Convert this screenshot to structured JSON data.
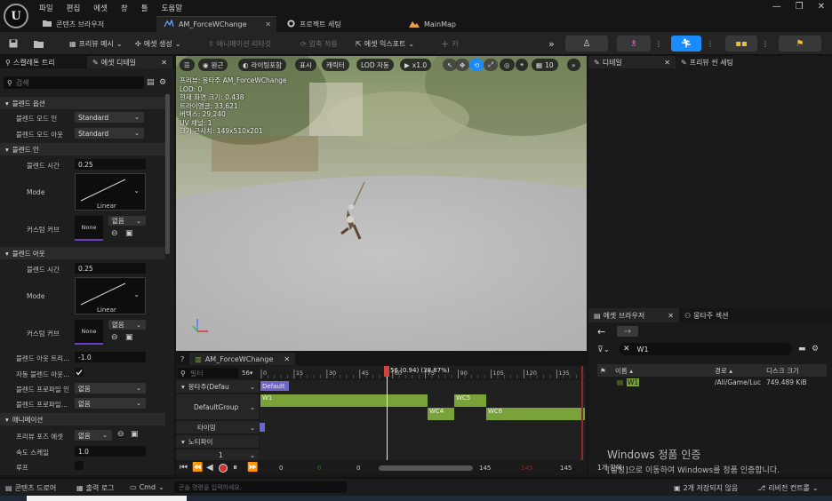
{
  "app": {
    "logo_letter": "U"
  },
  "menu": [
    "파일",
    "편집",
    "에셋",
    "창",
    "툴",
    "도움말"
  ],
  "window_controls": {
    "minimize": "—",
    "restore": "❐",
    "close": "✕"
  },
  "tabs": [
    {
      "label": "콘텐츠 브라우저",
      "icon": "folder-icon"
    },
    {
      "label": "AM_ForceWChange",
      "icon": "montage-icon",
      "active": true,
      "close": "✕"
    },
    {
      "label": "프로젝트 세팅",
      "icon": "gear-icon"
    },
    {
      "label": "MainMap",
      "icon": "map-icon"
    }
  ],
  "toolbar": {
    "preview_mesh": "프리뷰 메시",
    "create_asset": "에셋 생성",
    "anim_retarget": "애니메이션 리타깃",
    "apply_compression": "압축 적용",
    "export_asset": "에셋 익스포트",
    "key": "키"
  },
  "left_panel": {
    "tabs": [
      "스켈레톤 트리",
      "에셋 디테일"
    ],
    "search_placeholder": "검색",
    "blend_options": {
      "header": "블렌드 옵션",
      "blend_mode_in_label": "블렌드 모드 인",
      "blend_mode_in": "Standard",
      "blend_mode_out_label": "블렌드 모드 아웃",
      "blend_mode_out": "Standard"
    },
    "blend_in": {
      "header": "블렌드 인",
      "time_label": "블렌드 시간",
      "time": "0.25",
      "mode_label": "Mode",
      "mode": "Linear",
      "curve_label": "커스텀 커브",
      "curve": "None",
      "curve_combo": "없음"
    },
    "blend_out": {
      "header": "블렌드 아웃",
      "time_label": "블렌드 시간",
      "time": "0.25",
      "mode_label": "Mode",
      "mode": "Linear",
      "curve_label": "커스텀 커브",
      "curve": "None",
      "curve_combo": "없음"
    },
    "misc": {
      "blend_out_trigger_label": "블렌드 아웃 트리...",
      "blend_out_trigger": "-1.0",
      "auto_blend_out_label": "자동 블렌드 아웃...",
      "blend_profile_in_label": "블렌드 프로파일 인",
      "blend_profile_in": "없음",
      "blend_profile_out_label": "블렌드 프로파일...",
      "blend_profile_out": "없음"
    },
    "animation": {
      "header": "애니메이션",
      "preview_pose_label": "프리뷰 포즈 에셋",
      "preview_pose": "없음",
      "rate_scale_label": "속도 스케일",
      "rate_scale": "1.0",
      "loop_label": "루프"
    }
  },
  "viewport": {
    "toolbar": [
      "원근",
      "라이팅포함",
      "표시",
      "캐릭터",
      "LOD 자동",
      "x1.0",
      "10"
    ],
    "info": [
      "프리뷰: 몽타주 AM_ForceWChange",
      "LOD: 0",
      "현재 화면 크기: 0.438",
      "트라이앵글: 33,621",
      "버텍스: 29,240",
      "UV 채널: 1",
      "크기 근사치: 149x510x201"
    ]
  },
  "right_top": {
    "tabs": [
      "디테일",
      "프리뷰 씬 세팅"
    ]
  },
  "asset_browser": {
    "tabs": [
      "에셋 브라우저",
      "몽타주 섹션"
    ],
    "filter_value": "W1",
    "columns": [
      "이름",
      "경로",
      "디스크 크기"
    ],
    "rows": [
      {
        "name": "W1",
        "path": "/All/Game/Luc",
        "size": "749.489 KiB"
      }
    ],
    "count": "1개 항목"
  },
  "montage_panel": {
    "tab": "AM_ForceWChange",
    "filter_placeholder": "필터",
    "frame_count": "56",
    "playhead_label": "56 (0.94) (38.87%)",
    "ticks": [
      "0",
      "15",
      "30",
      "45",
      "60",
      "75",
      "90",
      "105",
      "120",
      "135"
    ],
    "tracks": {
      "montage": "몽타주(Defau",
      "slot": "DefaultGroup",
      "timing": "타이밍",
      "notifies": "노티파이",
      "notify_index": "1"
    },
    "section_label": "Default",
    "segments": [
      "W1",
      "WC4",
      "WC5",
      "WC6"
    ],
    "transport": {
      "start": "0",
      "mid1": "0",
      "mid2": "0",
      "end1": "145",
      "end2": "145",
      "end3": "145"
    }
  },
  "statusbar": {
    "content_drawer": "콘텐츠 드로어",
    "output_log": "출력 로그",
    "cmd": "Cmd",
    "console_placeholder": "콘솔 명령을 입력하세요.",
    "unsaved": "2개 저장되지 않음",
    "revision": "리비전 컨트롤"
  },
  "watermark": {
    "title": "Windows 정품 인증",
    "body": "[설정]으로 이동하여 Windows를 정품 인증합니다."
  },
  "colors": {
    "accent_blue": "#1a8cff",
    "segment_green": "#7aa23a",
    "playhead_red": "#d0453a",
    "section_purple": "#6d65c9"
  }
}
